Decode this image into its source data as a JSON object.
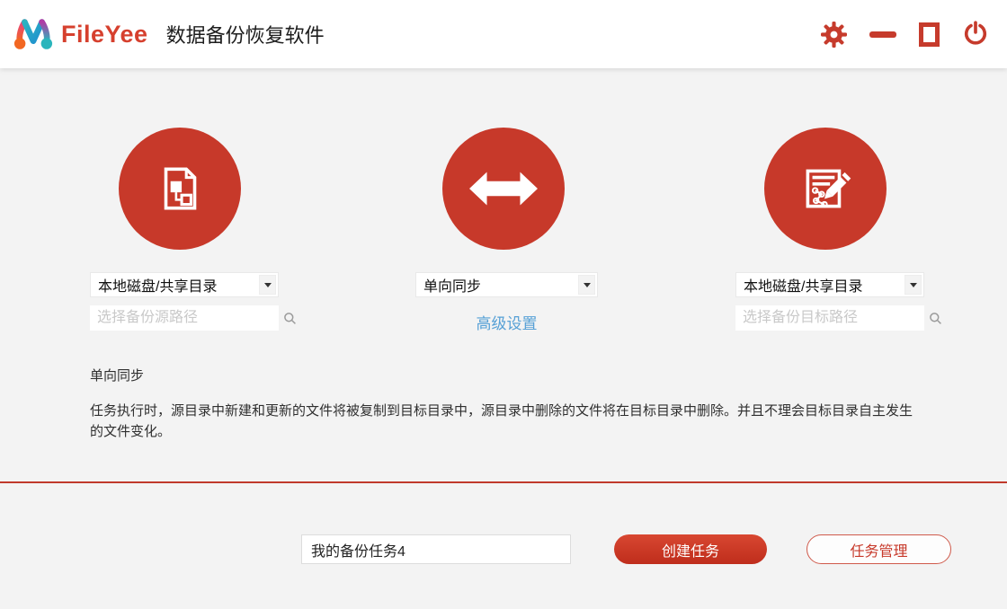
{
  "header": {
    "brand": "FileYee",
    "app_title": "数据备份恢复软件",
    "window_controls": [
      "settings",
      "minimize",
      "maximize",
      "close"
    ]
  },
  "source": {
    "type_value": "本地磁盘/共享目录",
    "path_placeholder": "选择备份源路径"
  },
  "sync": {
    "mode_value": "单向同步",
    "advanced_link": "高级设置"
  },
  "target": {
    "type_value": "本地磁盘/共享目录",
    "path_placeholder": "选择备份目标路径"
  },
  "description": {
    "title": "单向同步",
    "body": "任务执行时，源目录中新建和更新的文件将被复制到目标目录中，源目录中删除的文件将在目标目录中删除。并且不理会目标目录自主发生的文件变化。"
  },
  "footer": {
    "task_name_value": "我的备份任务4",
    "create_button": "创建任务",
    "manage_button": "任务管理"
  },
  "icons": {
    "source_circle": "document-blocks-icon",
    "mode_circle": "double-arrow-icon",
    "target_circle": "edit-document-icon",
    "inputs": "search-icon"
  },
  "colors": {
    "accent_red": "#c7392a",
    "brand_red": "#d6402e",
    "link_blue": "#56a0d6",
    "body_bg": "#f3f3f3"
  }
}
